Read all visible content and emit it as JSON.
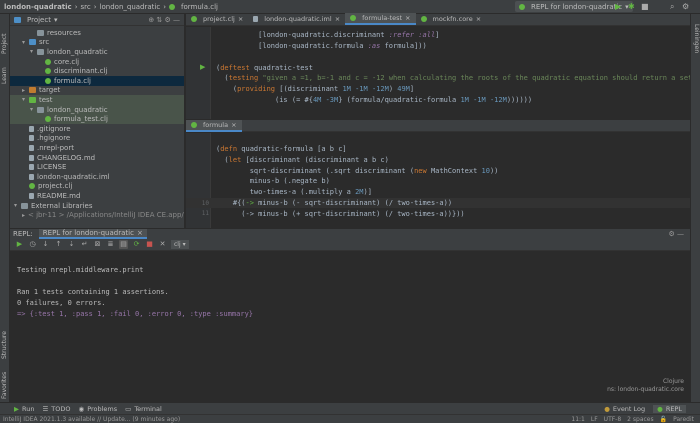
{
  "titlebar": {
    "project": "london-quadratic",
    "crumbs": [
      "src",
      "london_quadratic"
    ],
    "file": "formula.clj",
    "run_config": "REPL for london-quadratic"
  },
  "left_strip": [
    "Project",
    "Learn",
    "Structure",
    "Favorites"
  ],
  "right_strip": [
    "Leiningen"
  ],
  "project_panel": {
    "title": "Project",
    "items": [
      {
        "label": "resources",
        "indent": 2,
        "kind": "folder",
        "arrow": ""
      },
      {
        "label": "src",
        "indent": 1,
        "kind": "folder-src",
        "arrow": "▾"
      },
      {
        "label": "london_quadratic",
        "indent": 2,
        "kind": "folder",
        "arrow": "▾"
      },
      {
        "label": "core.clj",
        "indent": 3,
        "kind": "clj",
        "arrow": ""
      },
      {
        "label": "discriminant.clj",
        "indent": 3,
        "kind": "clj",
        "arrow": ""
      },
      {
        "label": "formula.clj",
        "indent": 3,
        "kind": "clj",
        "arrow": "",
        "selected": true
      },
      {
        "label": "target",
        "indent": 1,
        "kind": "folder-orange",
        "arrow": "▸"
      },
      {
        "label": "test",
        "indent": 1,
        "kind": "folder-test",
        "arrow": "▾",
        "test": true
      },
      {
        "label": "london_quadratic",
        "indent": 2,
        "kind": "folder",
        "arrow": "▾",
        "test": true
      },
      {
        "label": "formula_test.clj",
        "indent": 3,
        "kind": "clj",
        "arrow": "",
        "test": true
      },
      {
        "label": ".gitignore",
        "indent": 1,
        "kind": "file",
        "arrow": ""
      },
      {
        "label": ".hgignore",
        "indent": 1,
        "kind": "file",
        "arrow": ""
      },
      {
        "label": ".nrepl-port",
        "indent": 1,
        "kind": "file",
        "arrow": ""
      },
      {
        "label": "CHANGELOG.md",
        "indent": 1,
        "kind": "file",
        "arrow": ""
      },
      {
        "label": "LICENSE",
        "indent": 1,
        "kind": "file",
        "arrow": ""
      },
      {
        "label": "london-quadratic.iml",
        "indent": 1,
        "kind": "file",
        "arrow": ""
      },
      {
        "label": "project.clj",
        "indent": 1,
        "kind": "clj",
        "arrow": ""
      },
      {
        "label": "README.md",
        "indent": 1,
        "kind": "file",
        "arrow": ""
      },
      {
        "label": "External Libraries",
        "indent": 0,
        "kind": "folder",
        "arrow": "▾"
      },
      {
        "label": "< jbr-11 > /Applications/IntelliJ IDEA CE.app/Con",
        "indent": 1,
        "kind": "folder",
        "arrow": "▸"
      }
    ]
  },
  "editor_tabs_top": [
    "project.clj",
    "london-quadratic.iml",
    "formula-test",
    "mockfn.core"
  ],
  "editor_top_lines": [
    {
      "num": "",
      "html": "          [london-quadratic.discriminant <span class='kw'>:refer :all</span>]"
    },
    {
      "num": "",
      "html": "          [london-quadratic.formula <span class='kw'>:as</span> formula]))"
    },
    {
      "num": "",
      "html": ""
    },
    {
      "num": "",
      "html": "(<span class='k'>deftest</span> quadratic-test"
    },
    {
      "num": "",
      "html": "  (<span class='k'>testing</span> <span class='s'>\"given a =1, b=-1 and c = -12 when calculating the roots of the quadratic equation should return a set containi</span>"
    },
    {
      "num": "",
      "html": "    (<span class='k'>providing</span> [(discriminant <span class='n'>1M -1M -12M</span>) <span class='n'>49M</span>]"
    },
    {
      "num": "",
      "html": "              (is (= #{<span class='n'>4M -3M</span>} (formula/quadratic-formula <span class='n'>1M -1M -12M</span>))))))"
    }
  ],
  "editor_tab_bottom": "formula",
  "editor_bottom_lines": [
    {
      "num": "",
      "html": ""
    },
    {
      "num": "",
      "html": "(<span class='k'>defn</span> quadratic-formula [a b c]"
    },
    {
      "num": "",
      "html": "  (<span class='k'>let</span> [discriminant (discriminant a b c)"
    },
    {
      "num": "",
      "html": "        sqrt-discriminant (.sqrt discriminant (<span class='k'>new</span> MathContext <span class='n'>10</span>))"
    },
    {
      "num": "",
      "html": "        minus-b (.negate b)"
    },
    {
      "num": "",
      "html": "        two-times-a (.multiply a <span class='n'>2M</span>)]"
    },
    {
      "num": "10",
      "html": "    #{(<span class='g'>-&gt;</span> minus-b (- sqrt-discriminant) (/ two-times-a))",
      "current": true
    },
    {
      "num": "11",
      "html": "      (-&gt; minus-b (+ sqrt-discriminant) (/ two-times-a))}))"
    }
  ],
  "repl": {
    "header_label": "REPL:",
    "tab": "REPL for london-quadratic",
    "ns_select": "clj",
    "output": [
      "Testing nrepl.middleware.print",
      "",
      "Ran 1 tests containing 1 assertions.",
      "0 failures, 0 errors.",
      "=> {:test 1, :pass 1, :fail 0, :error 0, :type :summary}"
    ],
    "status_lang": "Clojure",
    "status_ns": "ns: london-quadratic.core"
  },
  "bottom_tools": [
    "Run",
    "TODO",
    "Problems",
    "Terminal"
  ],
  "bottom_tools_right": [
    "Event Log",
    "REPL"
  ],
  "statusbar": {
    "message": "IntelliJ IDEA 2021.1.3 available // Update... (9 minutes ago)",
    "position": "11:1",
    "line_sep": "LF",
    "encoding": "UTF-8",
    "indent": "2 spaces",
    "mode": "Paredit"
  },
  "colors": {
    "accent": "#4a88c7",
    "selection": "#0d293e",
    "test_bg": "#49544a"
  }
}
